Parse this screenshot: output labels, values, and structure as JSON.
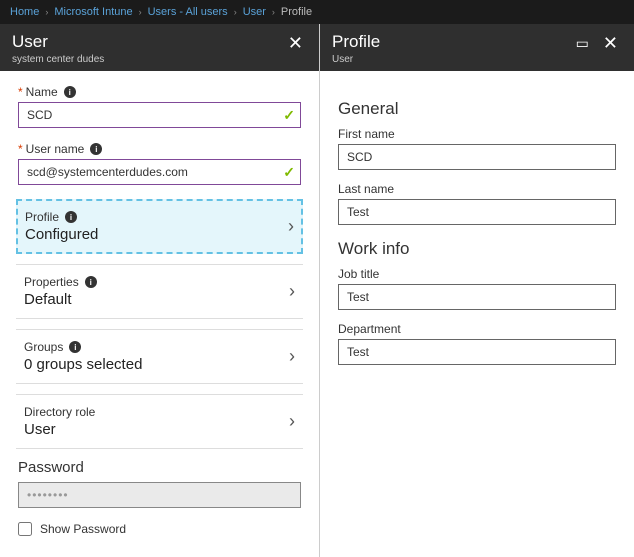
{
  "breadcrumbs": {
    "b0": "Home",
    "b1": "Microsoft Intune",
    "b2": "Users - All users",
    "b3": "User",
    "b4": "Profile"
  },
  "left": {
    "title": "User",
    "subtitle": "system center dudes",
    "fields": {
      "name_label": "Name",
      "name_value": "SCD",
      "user_label": "User name",
      "user_value": "scd@systemcenterdudes.com"
    },
    "nav": {
      "profile_label": "Profile",
      "profile_value": "Configured",
      "properties_label": "Properties",
      "properties_value": "Default",
      "groups_label": "Groups",
      "groups_value": "0 groups selected",
      "dirrole_label": "Directory role",
      "dirrole_value": "User"
    },
    "password": {
      "label": "Password",
      "show_label": "Show Password",
      "mask": "••••••••"
    }
  },
  "right": {
    "title": "Profile",
    "subtitle": "User",
    "general_label": "General",
    "work_label": "Work info",
    "first_name_label": "First name",
    "first_name_value": "SCD",
    "last_name_label": "Last name",
    "last_name_value": "Test",
    "job_title_label": "Job title",
    "job_title_value": "Test",
    "department_label": "Department",
    "department_value": "Test"
  }
}
